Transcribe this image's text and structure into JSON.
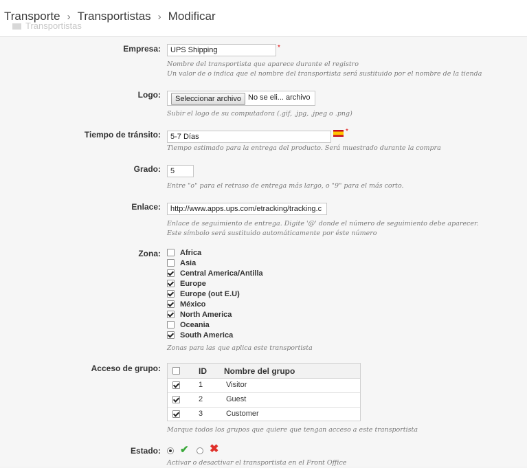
{
  "breadcrumb": {
    "items": [
      "Transporte",
      "Transportistas",
      "Modificar"
    ],
    "separator": "›",
    "ghost_label": "Transportistas"
  },
  "company": {
    "label": "Empresa:",
    "value": "UPS Shipping",
    "required": "*",
    "help_1": "Nombre del transportista que aparece durante el registro",
    "help_2": "Un valor de o indica que el nombre del transportista será sustituido por el nombre de la tienda"
  },
  "logo": {
    "label": "Logo:",
    "button": "Seleccionar archivo",
    "file_text": "No se eli... archivo",
    "help": "Subir el logo de su computadora (.gif, .jpg, .jpeg o .png)"
  },
  "transit": {
    "label": "Tiempo de tránsito:",
    "value": "5-7 Días",
    "required": "*",
    "language": "es",
    "help": "Tiempo estimado para la entrega del producto. Será muestrado durante la compra"
  },
  "grade": {
    "label": "Grado:",
    "value": "5",
    "help": "Entre \"o\" para el retraso de entrega más largo, o \"9\" para el más corto."
  },
  "link": {
    "label": "Enlace:",
    "value": "http://www.apps.ups.com/etracking/tracking.c",
    "help_1": "Enlace de seguimiento de entrega. Digite '@' donde el número de seguimiento debe aparecer.",
    "help_2": "Este símbolo será sustituido automáticamente por éste número"
  },
  "zones": {
    "label": "Zona:",
    "items": [
      {
        "name": "Africa",
        "checked": false
      },
      {
        "name": "Asia",
        "checked": false
      },
      {
        "name": "Central America/Antilla",
        "checked": true
      },
      {
        "name": "Europe",
        "checked": true
      },
      {
        "name": "Europe (out E.U)",
        "checked": true
      },
      {
        "name": "México",
        "checked": true
      },
      {
        "name": "North America",
        "checked": true
      },
      {
        "name": "Oceania",
        "checked": false
      },
      {
        "name": "South America",
        "checked": true
      }
    ],
    "help": "Zonas para las que aplica este transportista"
  },
  "groups": {
    "label": "Acceso de grupo:",
    "header": {
      "id": "ID",
      "name": "Nombre del grupo",
      "checked": false
    },
    "rows": [
      {
        "id": "1",
        "name": "Visitor",
        "checked": true
      },
      {
        "id": "2",
        "name": "Guest",
        "checked": true
      },
      {
        "id": "3",
        "name": "Customer",
        "checked": true
      }
    ],
    "help": "Marque todos los grupos que quiere que tengan acceso a este transportista"
  },
  "status": {
    "label": "Estado:",
    "enabled_icon": "check-icon",
    "disabled_icon": "cross-icon",
    "selected": "enabled",
    "help": "Activar o desactivar el transportista en el Front Office"
  }
}
